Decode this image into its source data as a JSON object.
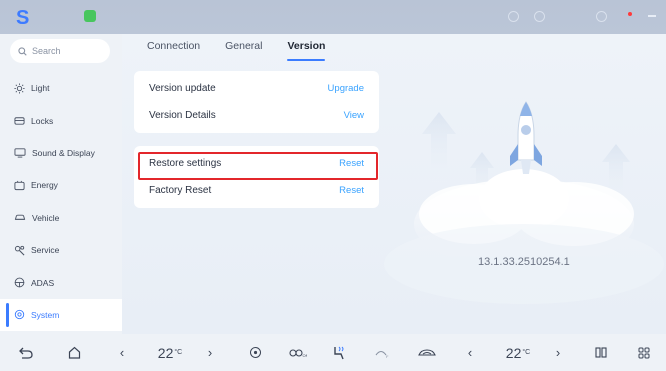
{
  "sidebar": {
    "search_placeholder": "Search",
    "items": [
      {
        "label": "Light",
        "icon": "sun-icon"
      },
      {
        "label": "Locks",
        "icon": "lock-icon"
      },
      {
        "label": "Sound & Display",
        "icon": "display-icon"
      },
      {
        "label": "Energy",
        "icon": "battery-icon"
      },
      {
        "label": "Vehicle",
        "icon": "car-icon"
      },
      {
        "label": "Service",
        "icon": "wrench-icon"
      },
      {
        "label": "ADAS",
        "icon": "steering-icon"
      },
      {
        "label": "System",
        "icon": "settings-icon",
        "active": true
      }
    ]
  },
  "tabs": [
    {
      "label": "Connection"
    },
    {
      "label": "General"
    },
    {
      "label": "Version",
      "active": true
    }
  ],
  "cards": [
    [
      {
        "label": "Version update",
        "action": "Upgrade"
      },
      {
        "label": "Version Details",
        "action": "View"
      }
    ],
    [
      {
        "label": "Restore settings",
        "action": "Reset"
      },
      {
        "label": "Factory Reset",
        "action": "Reset"
      }
    ]
  ],
  "version_number": "13.1.33.2510254.1",
  "bottom_bar": {
    "left_temp": "22",
    "right_temp": "22",
    "temp_unit": "°C"
  },
  "colors": {
    "accent": "#3b7cff",
    "action_text": "#3aa3ff",
    "highlight_border": "#e3262b",
    "sidebar_bg": "#eef2f7",
    "status_green": "#48c65e"
  }
}
